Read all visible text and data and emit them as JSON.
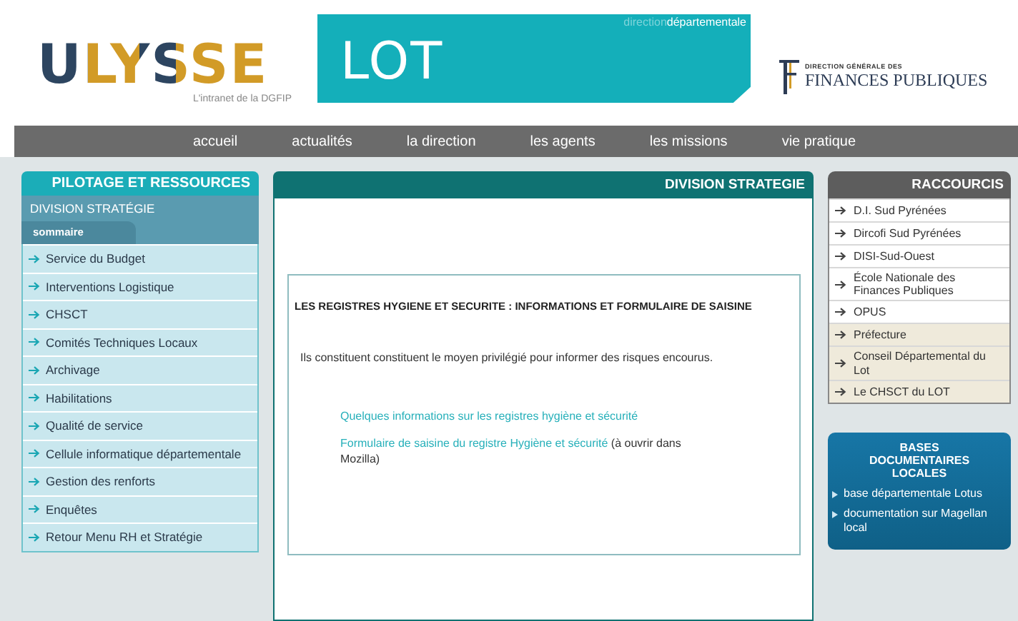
{
  "header": {
    "logo": {
      "name": "ULYSSE",
      "tagline": "L'intranet de la DGFIP"
    },
    "banner": {
      "caption": "direction**départementale**",
      "title": "LOT"
    },
    "partner": {
      "line_1": "DIRECTION GÉNÉRALE DES",
      "line_2": "FINANCES PUBLIQUES"
    }
  },
  "nav": [
    "accueil",
    "actualités",
    "la direction",
    "les agents",
    "les missions",
    "vie pratique"
  ],
  "sidebar": {
    "title": "PILOTAGE ET RESSOURCES",
    "section": "DIVISION STRATÉGIE",
    "tab": "sommaire",
    "items": [
      {
        "label": "Service du Budget"
      },
      {
        "label": "Interventions Logistique"
      },
      {
        "label": "CHSCT"
      },
      {
        "label": "Comités Techniques Locaux"
      },
      {
        "label": "Archivage"
      },
      {
        "label": "Habilitations"
      },
      {
        "label": "Qualité de service"
      },
      {
        "label": "Cellule informatique départementale"
      },
      {
        "label": "Gestion des renforts"
      },
      {
        "label": "Enquêtes"
      },
      {
        "label": "Retour Menu RH et Stratégie"
      }
    ]
  },
  "main": {
    "title": "DIVISION STRATEGIE",
    "heading": "LES REGISTRES HYGIENE ET SECURITE : INFORMATIONS ET FORMULAIRE DE SAISINE",
    "intro": "Ils constituent constituent  le moyen privilégié pour informer des risques encourus.",
    "links": [
      {
        "label": "Quelques informations sur les registres hygiène et sécurité"
      },
      {
        "label": "Formulaire de saisine du registre Hygiène et sécurité",
        "note": "(à ouvrir dans Mozilla)"
      }
    ]
  },
  "shortcuts": {
    "title": "RACCOURCIS",
    "items": [
      {
        "label": "D.I. Sud Pyrénées",
        "shaded": false
      },
      {
        "label": "Dircofi Sud Pyrénées",
        "shaded": false
      },
      {
        "label": "DISI-Sud-Ouest",
        "shaded": false
      },
      {
        "label": "École Nationale des Finances Publiques",
        "shaded": false
      },
      {
        "label": "OPUS",
        "shaded": false
      },
      {
        "label": "Préfecture",
        "shaded": true
      },
      {
        "label": "Conseil Départemental du Lot",
        "shaded": true
      },
      {
        "label": "Le CHSCT du LOT",
        "shaded": true
      }
    ]
  },
  "documents": {
    "title": "BASES DOCUMENTAIRES LOCALES",
    "items": [
      {
        "label": "base départementale Lotus"
      },
      {
        "label": "documentation sur Magellan local"
      }
    ]
  }
}
